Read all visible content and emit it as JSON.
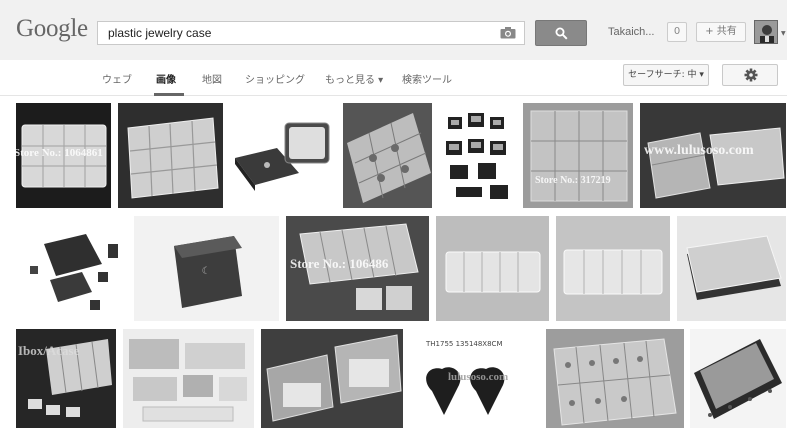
{
  "header": {
    "logo": "Google",
    "search_value": "plastic jewelry case",
    "user_name": "Takaich...",
    "notifications": "0",
    "share_label": "+ 共有"
  },
  "nav": {
    "tabs": [
      "ウェブ",
      "画像",
      "地図",
      "ショッピング",
      "もっと見る ▾",
      "検索ツール"
    ],
    "active_tab": "画像",
    "safesearch_label": "セーフサーチ: 中 ▾"
  },
  "results": {
    "watermarks": [
      "Store No.: 1064861",
      "Store No.: 317219",
      "www.lulusoso.com",
      "Store No.: 106486",
      "Ibox/Acase",
      "lulusoso.com",
      "TH1755 135148X8CM"
    ]
  },
  "icons": [
    "camera-icon",
    "search-icon",
    "gear-icon"
  ]
}
